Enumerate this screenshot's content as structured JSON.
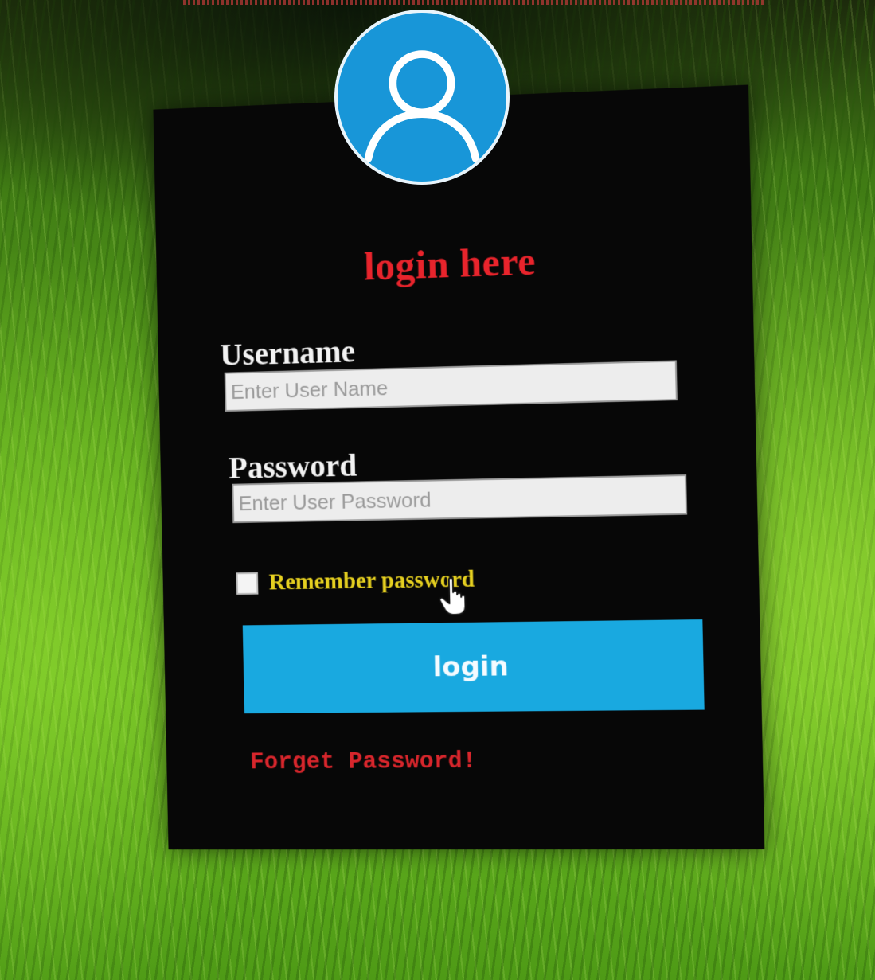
{
  "login_form": {
    "title": "login here",
    "username": {
      "label": "Username",
      "placeholder": "Enter User Name",
      "value": ""
    },
    "password": {
      "label": "Password",
      "placeholder": "Enter User Password",
      "value": ""
    },
    "remember": {
      "label": "Remember password",
      "checked": false
    },
    "login_button": "login",
    "forgot_link": "Forget Password!"
  },
  "icons": {
    "avatar": "user-avatar-icon",
    "cursor": "hand-pointer-icon"
  },
  "colors": {
    "panel_background": "#070707",
    "title": "#e8242c",
    "labels": "#f2f2f2",
    "remember_label": "#e6d020",
    "login_button": "#19a9e0",
    "avatar_circle": "#1896d8",
    "forgot_link": "#d8262c"
  }
}
